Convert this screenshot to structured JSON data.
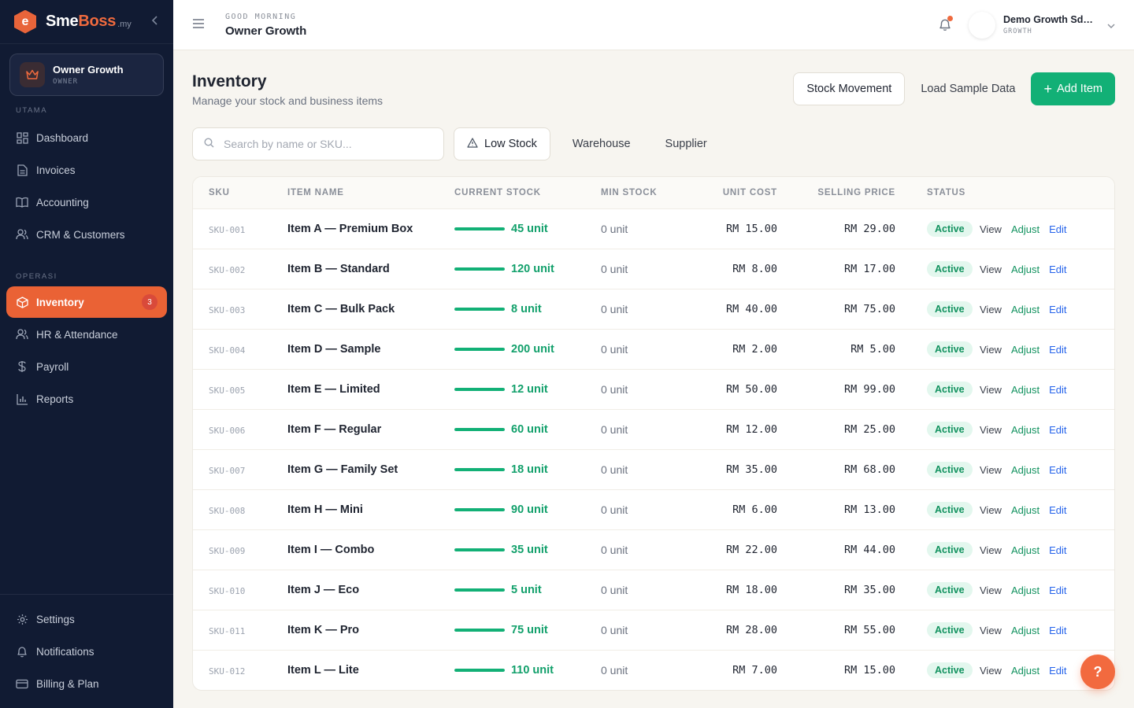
{
  "brand": {
    "name_a": "Sme",
    "name_b": "Boss",
    "tld": ".my",
    "logo_letter": "e"
  },
  "user": {
    "name": "Owner Growth",
    "role": "OWNER"
  },
  "sidebar": {
    "section_main": "UTAMA",
    "main_items": [
      {
        "label": "Dashboard",
        "icon": "grid-icon"
      },
      {
        "label": "Invoices",
        "icon": "document-icon"
      },
      {
        "label": "Accounting",
        "icon": "book-icon"
      },
      {
        "label": "CRM & Customers",
        "icon": "users-icon"
      }
    ],
    "section_ops": "OPERASI",
    "ops_items": [
      {
        "label": "Inventory",
        "icon": "box-icon",
        "badge": "3",
        "active": true
      },
      {
        "label": "HR & Attendance",
        "icon": "people-icon"
      },
      {
        "label": "Payroll",
        "icon": "dollar-icon"
      },
      {
        "label": "Reports",
        "icon": "bar-chart-icon"
      }
    ],
    "bottom_items": [
      {
        "label": "Settings",
        "icon": "gear-icon"
      },
      {
        "label": "Notifications",
        "icon": "bell-icon"
      },
      {
        "label": "Billing & Plan",
        "icon": "card-icon"
      }
    ]
  },
  "topbar": {
    "greeting": "GOOD MORNING",
    "name": "Owner Growth",
    "company_name": "Demo Growth Sdn ...",
    "company_plan": "GROWTH"
  },
  "page": {
    "title": "Inventory",
    "subtitle": "Manage your stock and business items",
    "btn_stock_movement": "Stock Movement",
    "btn_load_sample": "Load Sample Data",
    "btn_add_item": "Add Item"
  },
  "filters": {
    "search_placeholder": "Search by name or SKU...",
    "low_stock": "Low Stock",
    "warehouse": "Warehouse",
    "supplier": "Supplier"
  },
  "table": {
    "headers": [
      "SKU",
      "ITEM NAME",
      "CURRENT STOCK",
      "MIN STOCK",
      "UNIT COST",
      "SELLING PRICE",
      "STATUS"
    ],
    "action_labels": {
      "view": "View",
      "adjust": "Adjust",
      "edit": "Edit"
    },
    "rows": [
      {
        "sku": "SKU-001",
        "name": "Item A — Premium Box",
        "stock": "45 unit",
        "min": "0 unit",
        "cost": "RM 15.00",
        "price": "RM 29.00",
        "status": "Active",
        "fill": 1.0
      },
      {
        "sku": "SKU-002",
        "name": "Item B — Standard",
        "stock": "120 unit",
        "min": "0 unit",
        "cost": "RM 8.00",
        "price": "RM 17.00",
        "status": "Active",
        "fill": 1.0
      },
      {
        "sku": "SKU-003",
        "name": "Item C — Bulk Pack",
        "stock": "8 unit",
        "min": "0 unit",
        "cost": "RM 40.00",
        "price": "RM 75.00",
        "status": "Active",
        "fill": 1.0
      },
      {
        "sku": "SKU-004",
        "name": "Item D — Sample",
        "stock": "200 unit",
        "min": "0 unit",
        "cost": "RM 2.00",
        "price": "RM 5.00",
        "status": "Active",
        "fill": 1.0
      },
      {
        "sku": "SKU-005",
        "name": "Item E — Limited",
        "stock": "12 unit",
        "min": "0 unit",
        "cost": "RM 50.00",
        "price": "RM 99.00",
        "status": "Active",
        "fill": 1.0
      },
      {
        "sku": "SKU-006",
        "name": "Item F — Regular",
        "stock": "60 unit",
        "min": "0 unit",
        "cost": "RM 12.00",
        "price": "RM 25.00",
        "status": "Active",
        "fill": 1.0
      },
      {
        "sku": "SKU-007",
        "name": "Item G — Family Set",
        "stock": "18 unit",
        "min": "0 unit",
        "cost": "RM 35.00",
        "price": "RM 68.00",
        "status": "Active",
        "fill": 1.0
      },
      {
        "sku": "SKU-008",
        "name": "Item H — Mini",
        "stock": "90 unit",
        "min": "0 unit",
        "cost": "RM 6.00",
        "price": "RM 13.00",
        "status": "Active",
        "fill": 1.0
      },
      {
        "sku": "SKU-009",
        "name": "Item I — Combo",
        "stock": "35 unit",
        "min": "0 unit",
        "cost": "RM 22.00",
        "price": "RM 44.00",
        "status": "Active",
        "fill": 1.0
      },
      {
        "sku": "SKU-010",
        "name": "Item J — Eco",
        "stock": "5 unit",
        "min": "0 unit",
        "cost": "RM 18.00",
        "price": "RM 35.00",
        "status": "Active",
        "fill": 1.0
      },
      {
        "sku": "SKU-011",
        "name": "Item K — Pro",
        "stock": "75 unit",
        "min": "0 unit",
        "cost": "RM 28.00",
        "price": "RM 55.00",
        "status": "Active",
        "fill": 1.0
      },
      {
        "sku": "SKU-012",
        "name": "Item L — Lite",
        "stock": "110 unit",
        "min": "0 unit",
        "cost": "RM 7.00",
        "price": "RM 15.00",
        "status": "Active",
        "fill": 1.0
      }
    ]
  },
  "help_label": "?",
  "colors": {
    "accent": "#ea6235",
    "primary": "#12b076",
    "sidebar_bg": "#111b33"
  }
}
